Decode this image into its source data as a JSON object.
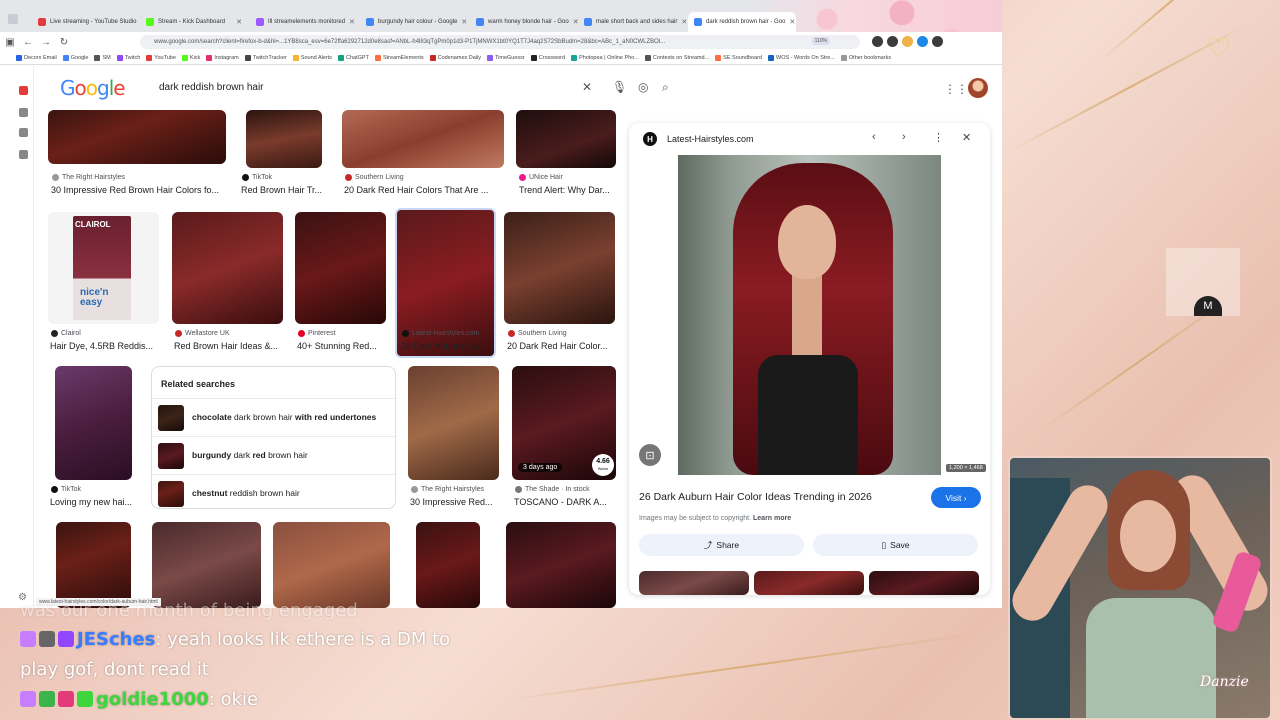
{
  "tabs": [
    {
      "label": "Live streaming - YouTube Studio",
      "color": "#e33b3b"
    },
    {
      "label": "Stream - Kick Dashboard",
      "color": "#53fc18"
    },
    {
      "label": "Ill streamelements monitored",
      "color": "#9b59ff"
    },
    {
      "label": "burgundy hair colour - Google",
      "color": "#4285f4"
    },
    {
      "label": "warm honey blonde hair - Goo",
      "color": "#4285f4"
    },
    {
      "label": "male short back and sides hair",
      "color": "#4285f4"
    },
    {
      "label": "dark reddish brown hair - Goo",
      "color": "#4285f4",
      "active": true
    }
  ],
  "toolbar": {
    "url": "www.google.com/search?client=firefox-b-d&hl=...1YB8sca_esv=6e72ffa6292712d0e8sasf=ANbL-h4l83qTgPm0p1d3-P1TjMNWX1bt0YQ1T7J4aq2S72SbBudm=28&bc=ABc_1_aN0CWLZBOl...",
    "zoom": "110%"
  },
  "bookmarks": [
    {
      "label": "Decorx Email",
      "color": "#2563eb"
    },
    {
      "label": "Google",
      "color": "#4285f4"
    },
    {
      "label": "SM",
      "color": "#555"
    },
    {
      "label": "Twitch",
      "color": "#9146ff"
    },
    {
      "label": "YouTube",
      "color": "#e33b3b"
    },
    {
      "label": "Kick",
      "color": "#53fc18"
    },
    {
      "label": "Instagram",
      "color": "#e1306c"
    },
    {
      "label": "TwitchTracker",
      "color": "#444"
    },
    {
      "label": "Sound Alerts",
      "color": "#f5b335"
    },
    {
      "label": "ChatGPT",
      "color": "#10a37f"
    },
    {
      "label": "StreamElements",
      "color": "#ff6e40"
    },
    {
      "label": "Codenames Daily",
      "color": "#c62828"
    },
    {
      "label": "TimeGuessr",
      "color": "#8b5cf6"
    },
    {
      "label": "Crossword",
      "color": "#222"
    },
    {
      "label": "Photopea | Online Pho...",
      "color": "#18a497"
    },
    {
      "label": "Contests on Streamd...",
      "color": "#555"
    },
    {
      "label": "SE Soundboard",
      "color": "#ff6e40"
    },
    {
      "label": "WOS - Words On Stre...",
      "color": "#1565c0"
    },
    {
      "label": "Other bookmarks",
      "color": "#999"
    }
  ],
  "search": {
    "logo": "Google",
    "query": "dark reddish brown hair"
  },
  "results": [
    {
      "source": "The Right Hairstyles",
      "title": "30 Impressive Red Brown Hair Colors fo...",
      "color": "#999"
    },
    {
      "source": "TikTok",
      "title": "Red Brown Hair Tr...",
      "color": "#111"
    },
    {
      "source": "Southern Living",
      "title": "20 Dark Red Hair Colors That Are ...",
      "color": "#c62828"
    },
    {
      "source": "UNice Hair",
      "title": "Trend Alert: Why Dar...",
      "color": "#e91e8c"
    },
    {
      "source": "Clairol",
      "title": "Hair Dye, 4.5RB Reddis...",
      "color": "#222"
    },
    {
      "source": "Wellastore UK",
      "title": "Red Brown Hair Ideas &...",
      "color": "#c62828"
    },
    {
      "source": "Pinterest",
      "title": "40+ Stunning Red...",
      "color": "#e60023"
    },
    {
      "source": "Latest-Hairstyles.com",
      "title": "26 Dark Auburn Ha...",
      "color": "#111"
    },
    {
      "source": "Southern Living",
      "title": "20 Dark Red Hair Color...",
      "color": "#c62828"
    },
    {
      "source": "TikTok",
      "title": "Loving my new hai...",
      "color": "#111"
    },
    {
      "source": "The Right Hairstyles",
      "title": "30 Impressive Red...",
      "color": "#999"
    },
    {
      "source": "The Shade · In stock",
      "title": "TOSCANO - DARK A...",
      "color": "#777"
    }
  ],
  "clairol": {
    "brand": "CLAIROL",
    "line1": "nice'n",
    "line2": "easy"
  },
  "badges": {
    "days_ago": "3 days ago",
    "rating": "4.66",
    "rating_sub": "Warm"
  },
  "related": {
    "heading": "Related searches",
    "items": [
      {
        "pre": "chocolate",
        "mid": " dark brown hair ",
        "post": "with red undertones"
      },
      {
        "pre": "burgundy",
        "mid": " dark ",
        "bold2": "red",
        "post": " brown hair"
      },
      {
        "pre": "chestnut",
        "mid": " reddish brown hair",
        "post": ""
      }
    ]
  },
  "preview": {
    "site": "Latest-Hairstyles.com",
    "site_initial": "H",
    "dimensions": "1,200 × 1,468",
    "title": "26 Dark Auburn Hair Color Ideas Trending in 2026",
    "visit_label": "Visit",
    "copyright": "Images may be subject to copyright.",
    "learn_more": "Learn more",
    "share_label": "Share",
    "save_label": "Save"
  },
  "status_url": "www.latest-hairstyles.com/color/dark-auburn-hair.html",
  "chat": [
    {
      "text": "was our one month of being engaged"
    },
    {
      "user": "JESches",
      "message": ": yeah looks lik ethere is a DM to"
    },
    {
      "text": "play gof, dont read it"
    },
    {
      "user": "goldie1000",
      "message": ": okie"
    }
  ],
  "overlay": {
    "logo": "Danzie",
    "m_logo": "M"
  }
}
